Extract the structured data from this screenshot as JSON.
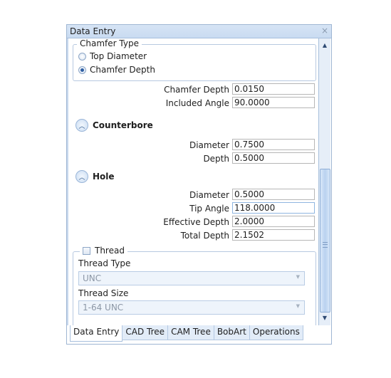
{
  "window": {
    "title": "Data Entry",
    "close_label": "×"
  },
  "chamfer": {
    "group_label": "Chamfer Type",
    "options": [
      {
        "label": "Top Diameter",
        "selected": false
      },
      {
        "label": "Chamfer Depth",
        "selected": true
      }
    ],
    "fields": [
      {
        "label": "Chamfer Depth",
        "value": "0.0150"
      },
      {
        "label": "Included Angle",
        "value": "90.0000"
      }
    ]
  },
  "counterbore": {
    "title": "Counterbore",
    "fields": [
      {
        "label": "Diameter",
        "value": "0.7500"
      },
      {
        "label": "Depth",
        "value": "0.5000"
      }
    ]
  },
  "hole": {
    "title": "Hole",
    "fields": [
      {
        "label": "Diameter",
        "value": "0.5000"
      },
      {
        "label": "Tip Angle",
        "value": "118.0000"
      },
      {
        "label": "Effective Depth",
        "value": "2.0000"
      },
      {
        "label": "Total Depth",
        "value": "2.1502"
      }
    ]
  },
  "thread": {
    "checkbox_label": "Thread",
    "checked": false,
    "type_label": "Thread Type",
    "type_value": "UNC",
    "size_label": "Thread Size",
    "size_value": "1-64 UNC"
  },
  "scrollbar": {
    "position_fraction": 0.45,
    "visible_fraction": 0.55
  },
  "tabs": [
    {
      "label": "Data Entry",
      "active": true
    },
    {
      "label": "CAD Tree",
      "active": false
    },
    {
      "label": "CAM Tree",
      "active": false
    },
    {
      "label": "BobArt",
      "active": false
    },
    {
      "label": "Operations",
      "active": false
    }
  ]
}
